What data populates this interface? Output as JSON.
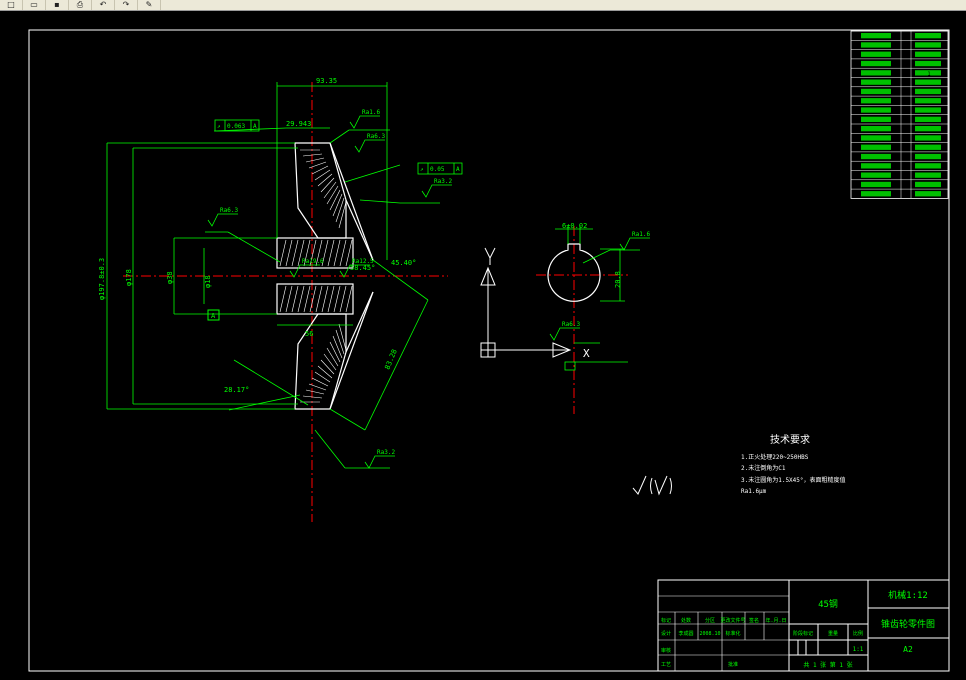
{
  "toolbar": {
    "buttons": [
      {
        "name": "new-file-icon",
        "glyph": "□"
      },
      {
        "name": "open-file-icon",
        "glyph": "▭"
      },
      {
        "name": "save-icon",
        "glyph": "▪"
      },
      {
        "name": "print-icon",
        "glyph": "⎙"
      },
      {
        "name": "undo-icon",
        "glyph": "↶"
      },
      {
        "name": "redo-icon",
        "glyph": "↷"
      },
      {
        "name": "match-properties-icon",
        "glyph": "✎"
      }
    ]
  },
  "drawing": {
    "colors": {
      "background": "#000000",
      "frame": "#ffffff",
      "dimension": "#00ff00",
      "centerline": "#ff0000",
      "section": "#ffffff"
    },
    "dimensions": {
      "top_width": "93.35",
      "face_width": "29.943",
      "outer_diameter": "φ197.8±0.3",
      "pitch_diameter": "φ178",
      "hub_diameter": "φ38",
      "bore": "φ18",
      "slant_length": "83.28",
      "face_angle": "28.17°",
      "cone_angle_a": "45.40°",
      "cone_angle_b": "58.45°",
      "hub_length": "56",
      "keyway_width": "6±0.02",
      "keyway_depth": "20.8",
      "datum_a": "A"
    },
    "roughness_labels": [
      "Ra1.6",
      "Ra6.3",
      "Ra3.2",
      "Ra6.3",
      "Ra19.6",
      "Ra12.5",
      "Ra1.6",
      "Ra6.3",
      "Ra3.2"
    ],
    "tolerance_frames": [
      {
        "symbol": "↗",
        "value": "0.063",
        "datum": "A"
      },
      {
        "symbol": "↗",
        "value": "0.05",
        "datum": "A"
      }
    ],
    "ucs": {
      "y_label": "Y",
      "x_label": "X"
    },
    "tech_requirements": {
      "title": "技术要求",
      "items": [
        "1.正火处理220~250HBS",
        "2.未注倒角为C1",
        "3.未注圆角为1.5X45°，表面粗糙度值",
        "Ra1.6μm"
      ]
    },
    "rough_symbol_text": "√ (√)",
    "param_table": {
      "rows": [
        [
          "",
          "",
          ""
        ],
        [
          "",
          "m",
          ""
        ],
        [
          "",
          "z",
          ""
        ],
        [
          "",
          "α",
          ""
        ],
        [
          "",
          "",
          "1"
        ],
        [
          "",
          "",
          ""
        ],
        [
          "",
          "",
          ""
        ],
        [
          "",
          "",
          ""
        ],
        [
          "",
          "",
          ""
        ],
        [
          "",
          "",
          ""
        ],
        [
          "",
          "",
          ""
        ],
        [
          "",
          "",
          ""
        ],
        [
          "",
          "",
          ""
        ],
        [
          "",
          "",
          ""
        ],
        [
          "",
          "",
          ""
        ],
        [
          "",
          "",
          ""
        ],
        [
          "",
          "",
          ""
        ],
        [
          "",
          "",
          ""
        ]
      ]
    },
    "title_block": {
      "material": "45钢",
      "school": "机械1:12",
      "drawing_name": "锥齿轮零件图",
      "sheet_size": "A2",
      "scale": "1:1",
      "sheet_info": "共 1 张  第 1 张",
      "header_cells": [
        "标记",
        "处数",
        "分区",
        "更改文件号",
        "签名",
        "年.月.日"
      ],
      "row2": [
        "设计",
        "李成圆",
        "2008.10",
        "标准化"
      ],
      "row3": [
        "审核"
      ],
      "row4": [
        "工艺",
        "批准"
      ],
      "stage_labels": [
        "阶段标记",
        "重量",
        "比例"
      ]
    }
  }
}
